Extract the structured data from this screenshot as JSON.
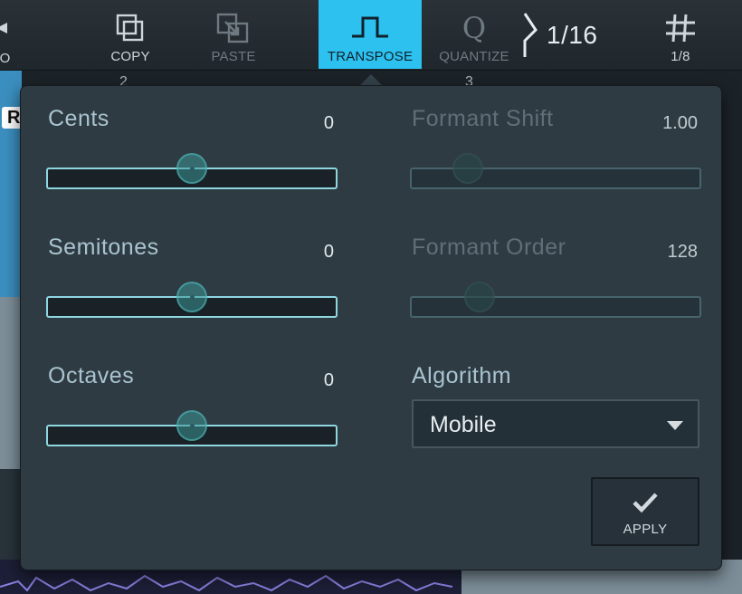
{
  "toolbar": {
    "undo_label": "DO",
    "copy_label": "COPY",
    "paste_label": "PASTE",
    "transpose_label": "TRANSPOSE",
    "quantize_label": "QUANTIZE",
    "quantize_icon_glyph": "Q",
    "grid_value": "1/16",
    "snap_label": "1/8"
  },
  "ruler": {
    "marker_a": "2",
    "marker_b": "3"
  },
  "track": {
    "letter": "R"
  },
  "transpose_panel": {
    "cents": {
      "label": "Cents",
      "value": "0",
      "level": 0.5,
      "enabled": true
    },
    "semitones": {
      "label": "Semitones",
      "value": "0",
      "level": 0.5,
      "enabled": true
    },
    "octaves": {
      "label": "Octaves",
      "value": "0",
      "level": 0.5,
      "enabled": true
    },
    "formant_shift": {
      "label": "Formant Shift",
      "value": "1.00",
      "level": 0.2,
      "enabled": false
    },
    "formant_order": {
      "label": "Formant Order",
      "value": "128",
      "level": 0.24,
      "enabled": false
    },
    "algorithm": {
      "label": "Algorithm",
      "selected": "Mobile"
    },
    "apply_label": "APPLY"
  },
  "colors": {
    "accent": "#2dc1f0",
    "panel_bg": "#2f3b43",
    "slider_border": "#8ed6e0",
    "label_active": "#a9c4d0",
    "label_disabled": "#5e6f78"
  }
}
